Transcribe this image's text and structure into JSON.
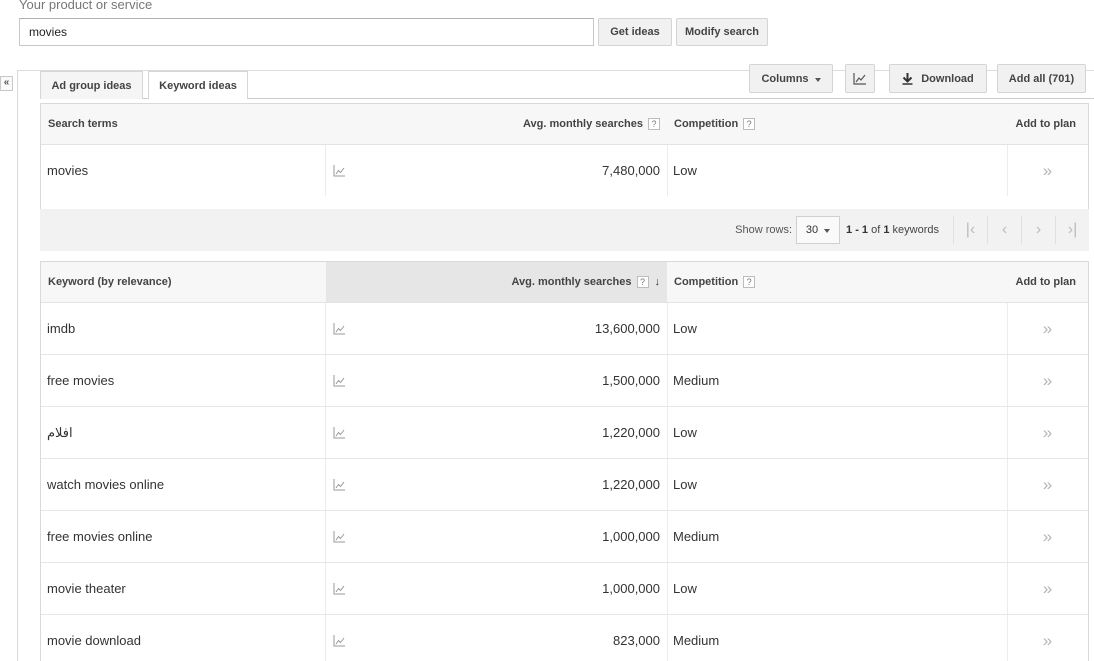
{
  "search": {
    "label": "Your product or service",
    "value": "movies",
    "get_ideas": "Get ideas",
    "modify_search": "Modify search"
  },
  "collapse": "«",
  "tabs": [
    {
      "label": "Ad group ideas",
      "active": false
    },
    {
      "label": "Keyword ideas",
      "active": true
    }
  ],
  "toolbar": {
    "columns": "Columns",
    "download": "Download",
    "add_all": "Add all (701)"
  },
  "search_terms_table": {
    "headers": {
      "term": "Search terms",
      "avg": "Avg. monthly searches",
      "competition": "Competition",
      "add": "Add to plan"
    },
    "rows": [
      {
        "term": "movies",
        "avg": "7,480,000",
        "competition": "Low"
      }
    ]
  },
  "pager": {
    "show_rows_label": "Show rows:",
    "rows_value": "30",
    "range_start": "1",
    "range_sep": " - ",
    "range_end": "1",
    "range_of": " of ",
    "range_total": "1",
    "range_unit": " keywords"
  },
  "keyword_table": {
    "headers": {
      "term": "Keyword (by relevance)",
      "avg": "Avg. monthly searches",
      "competition": "Competition",
      "add": "Add to plan"
    },
    "rows": [
      {
        "term": "imdb",
        "avg": "13,600,000",
        "competition": "Low"
      },
      {
        "term": "free movies",
        "avg": "1,500,000",
        "competition": "Medium"
      },
      {
        "term": "افلام",
        "avg": "1,220,000",
        "competition": "Low"
      },
      {
        "term": "watch movies online",
        "avg": "1,220,000",
        "competition": "Low"
      },
      {
        "term": "free movies online",
        "avg": "1,000,000",
        "competition": "Medium"
      },
      {
        "term": "movie theater",
        "avg": "1,000,000",
        "competition": "Low"
      },
      {
        "term": "movie download",
        "avg": "823,000",
        "competition": "Medium"
      }
    ]
  },
  "icons": {
    "help": "?",
    "sort": "↓",
    "add_to_plan": "»",
    "first": "|‹",
    "prev": "‹",
    "next": "›",
    "last": "›|"
  }
}
